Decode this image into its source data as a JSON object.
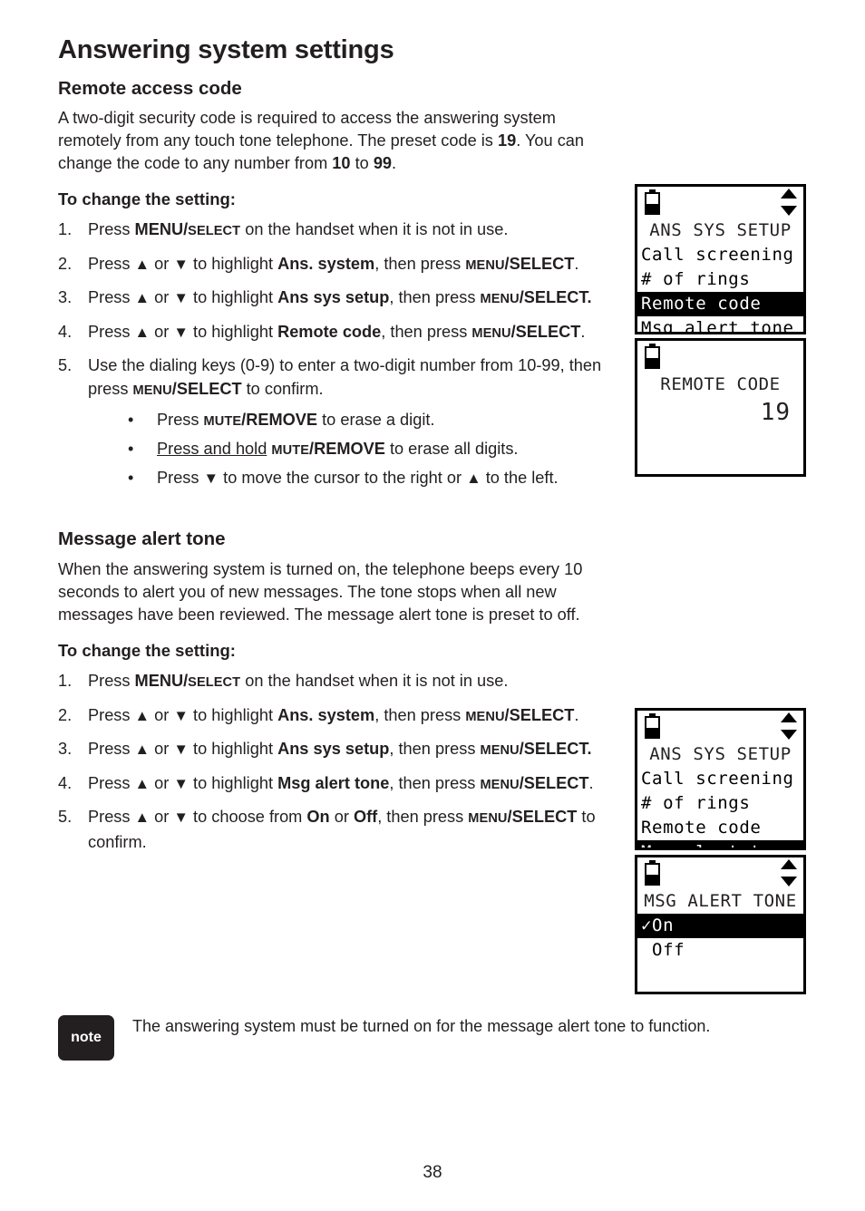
{
  "document": {
    "chapter_title": "Answering system settings",
    "page_number": "38"
  },
  "sections": [
    {
      "title": "Remote access code",
      "intro_parts": {
        "a": "A two-digit security code is required to access the answering system remotely from any touch tone telephone. The preset code is ",
        "b": "19",
        "c": ". You can change the code to any number from ",
        "d": "10",
        "e": " to ",
        "f": "99",
        "g": "."
      },
      "howto_label": "To change the setting:",
      "steps": [
        {
          "num": "1.",
          "p1": "Press ",
          "key_big": "MENU/",
          "key_small": "SELECT",
          "p2": " on the handset when it is not in use."
        },
        {
          "num": "2.",
          "p1": "Press ",
          "arrow_up": "▲",
          "mid": " or ",
          "arrow_down": "▼",
          "p2": " to highlight ",
          "target": "Ans. system",
          "p3": ", then press ",
          "key_small": "MENU",
          "key_big": "/SELECT",
          "p4": "."
        },
        {
          "num": "3.",
          "p1": "Press ",
          "arrow_up": "▲",
          "mid": " or ",
          "arrow_down": "▼",
          "p2": " to highlight ",
          "target": "Ans sys setup",
          "p3": ", then press ",
          "key_small": "MENU",
          "key_big": "/SELECT.",
          "p4": ""
        },
        {
          "num": "4.",
          "p1": "Press  ",
          "arrow_up": "▲",
          "mid": " or ",
          "arrow_down": "▼",
          "p2": " to highlight ",
          "target": "Remote code",
          "p3": ", then press ",
          "key_small": "MENU",
          "key_big": "/SELECT",
          "p4": "."
        },
        {
          "num": "5.",
          "p1": "Use the dialing keys (0-9) to enter a two-digit number from 10-99, then press ",
          "key_small": "MENU",
          "key_big": "/SELECT",
          "p2": " to confirm."
        }
      ],
      "bullets": [
        {
          "dot": "•",
          "p1": "Press ",
          "key_small": "MUTE",
          "key_big": "/REMOVE",
          "p2": " to erase a digit."
        },
        {
          "dot": "•",
          "underlined": "Press and hold",
          "p1": " ",
          "key_small": "MUTE",
          "key_big": "/REMOVE",
          "p2": " to erase all digits."
        },
        {
          "dot": "•",
          "p1": "Press ",
          "arrow_down": "▼",
          "p2": " to move the cursor to the right or ",
          "arrow_up": "▲",
          "p3": " to the left."
        }
      ]
    },
    {
      "title": "Message alert tone",
      "intro": "When the answering system is turned on, the telephone beeps every 10 seconds to alert you of new messages. The tone stops when all new messages have been reviewed. The message alert tone is preset to off.",
      "howto_label": "To change the setting:",
      "steps": [
        {
          "num": "1.",
          "p1": "Press ",
          "key_big": "MENU/",
          "key_small": "SELECT",
          "p2": " on the handset when it is not in use."
        },
        {
          "num": "2.",
          "p1": "Press ",
          "arrow_up": "▲",
          "mid": " or ",
          "arrow_down": "▼",
          "p2": " to highlight ",
          "target": "Ans. system",
          "p3": ", then press ",
          "key_small": "MENU",
          "key_big": "/SELECT",
          "p4": "."
        },
        {
          "num": "3.",
          "p1": "Press ",
          "arrow_up": "▲",
          "mid": " or ",
          "arrow_down": "▼",
          "p2": " to highlight ",
          "target": "Ans sys setup",
          "p3": ", then press ",
          "key_small": "MENU",
          "key_big": "/SELECT.",
          "p4": ""
        },
        {
          "num": "4.",
          "p1": "Press  ",
          "arrow_up": "▲",
          "mid": " or ",
          "arrow_down": "▼",
          "p2": " to highlight ",
          "target": "Msg alert tone",
          "p3": ", then press ",
          "key_small": "MENU",
          "key_big": "/SELECT",
          "p4": "."
        },
        {
          "num": "5.",
          "p1": "Press ",
          "arrow_up": "▲",
          "mid": " or ",
          "arrow_down": "▼",
          "p2": " to choose from ",
          "target": "On",
          "p3": " or ",
          "target2": "Off",
          "p4": ", then press ",
          "key_small": "MENU",
          "key_big": "/SELECT",
          "p5": " to confirm."
        }
      ]
    }
  ],
  "note": {
    "badge": "note",
    "text": "The answering system must be turned on for the message alert tone to function."
  },
  "lcd_screens": [
    {
      "id": "ans-sys-setup-remote-code",
      "battery": "battery-icon",
      "scroll": "scroll-arrows",
      "title": "ANS SYS SETUP",
      "items": [
        {
          "label": "Call screening",
          "selected": false
        },
        {
          "label": "# of rings",
          "selected": false
        },
        {
          "label": "Remote code",
          "selected": true
        },
        {
          "label": "Msg alert tone",
          "selected": false
        }
      ]
    },
    {
      "id": "remote-code-value",
      "battery": "battery-icon",
      "title": "REMOTE CODE",
      "value": "19"
    },
    {
      "id": "ans-sys-setup-msg-alert",
      "battery": "battery-icon",
      "scroll": "scroll-arrows",
      "title": "ANS SYS SETUP",
      "items": [
        {
          "label": "Call screening",
          "selected": false
        },
        {
          "label": "# of rings",
          "selected": false
        },
        {
          "label": "Remote code",
          "selected": false
        },
        {
          "label": "Msg alert tone",
          "selected": true
        }
      ]
    },
    {
      "id": "msg-alert-tone-options",
      "battery": "battery-icon",
      "scroll": "scroll-arrows",
      "title": "MSG ALERT TONE",
      "items": [
        {
          "label": "✓On",
          "selected": true
        },
        {
          "label": " Off",
          "selected": false
        }
      ]
    }
  ],
  "colors": {
    "ink": "#231f20",
    "lcd_background": "#ffffff",
    "lcd_highlight": "#000000",
    "note_badge_bg": "#231f20"
  }
}
